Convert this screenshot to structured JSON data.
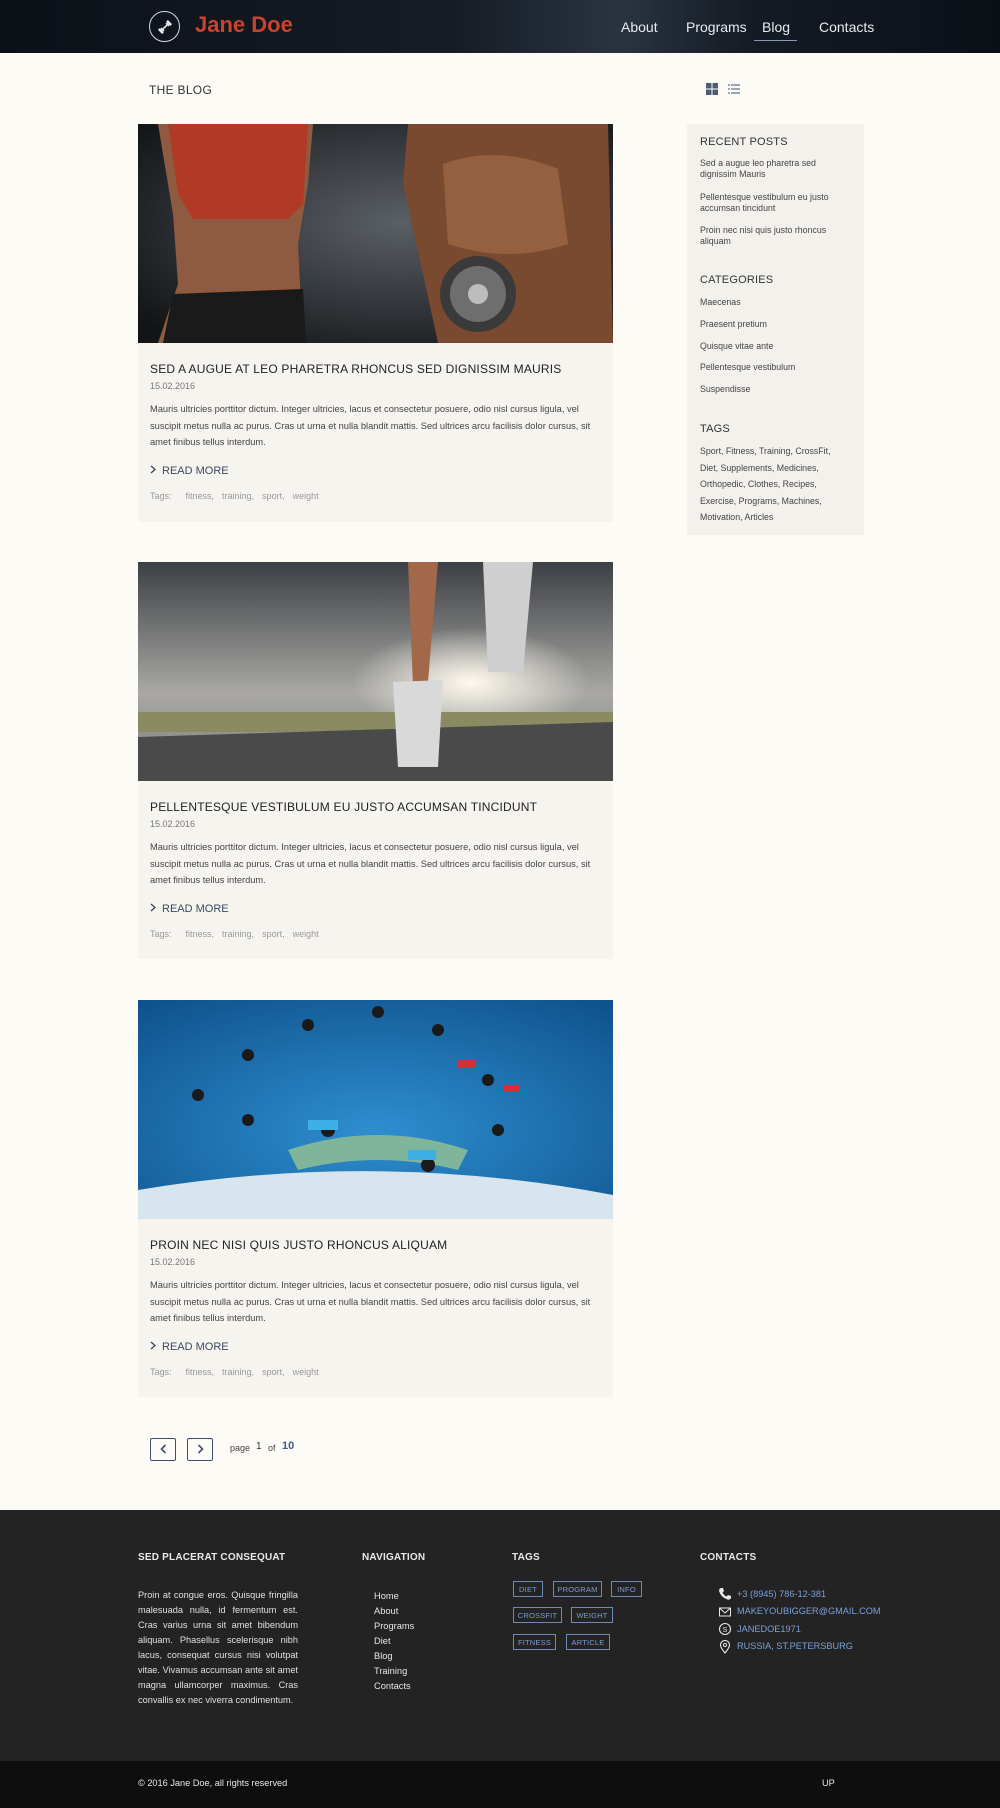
{
  "header": {
    "logo_text": "Jane Doe",
    "nav": [
      {
        "label": "About"
      },
      {
        "label": "Programs"
      },
      {
        "label": "Blog"
      },
      {
        "label": "Contacts"
      }
    ],
    "active_nav": "Blog",
    "logo_icon": "dumbbell-icon"
  },
  "blog": {
    "heading": "THE BLOG",
    "view_icons": [
      "grid-view-icon",
      "list-view-icon"
    ]
  },
  "posts": [
    {
      "title": "SED A AUGUE AT LEO PHARETRA RHONCUS SED DIGNISSIM MAURIS",
      "date": "15.02.2016",
      "text": "Mauris ultricies porttitor dictum. Integer ultricies, lacus et consectetur posuere, odio nisl cursus ligula, vel suscipit metus nulla ac purus. Cras ut urna et nulla blandit mattis. Sed ultrices arcu facilisis dolor cursus, sit amet finibus tellus interdum.",
      "read_more": "READ MORE",
      "tags_label": "Tags:",
      "tags": [
        "fitness,",
        "training,",
        "sport,",
        "weight"
      ]
    },
    {
      "title": "PELLENTESQUE VESTIBULUM EU JUSTO  ACCUMSAN TINCIDUNT",
      "date": "15.02.2016",
      "text": "Mauris ultricies porttitor dictum. Integer ultricies, lacus et consectetur posuere, odio nisl cursus ligula, vel suscipit metus nulla ac purus. Cras ut urna et nulla blandit mattis. Sed ultrices arcu facilisis dolor cursus, sit amet finibus tellus interdum.",
      "read_more": "READ MORE",
      "tags_label": "Tags:",
      "tags": [
        "fitness,",
        "training,",
        "sport,",
        "weight"
      ]
    },
    {
      "title": "PROIN NEC NISI QUIS JUSTO RHONCUS  ALIQUAM",
      "date": "15.02.2016",
      "text": "Mauris ultricies porttitor dictum. Integer ultricies, lacus et consectetur posuere, odio nisl cursus ligula, vel suscipit metus nulla ac purus. Cras ut urna et nulla blandit mattis. Sed ultrices arcu facilisis dolor cursus, sit amet finibus tellus interdum.",
      "read_more": "READ MORE",
      "tags_label": "Tags:",
      "tags": [
        "fitness,",
        "training,",
        "sport,",
        "weight"
      ]
    }
  ],
  "sidebar": {
    "recent_title": "RECENT POSTS",
    "recent_posts": [
      "Sed a augue leo pharetra sed dignissim Mauris",
      "Pellentesque vestibulum eu justo accumsan tincidunt",
      "Proin nec nisi quis justo rhoncus aliquam"
    ],
    "categories_title": "CATEGORIES",
    "categories": [
      "Maecenas",
      "Praesent pretium",
      "Quisque vitae ante",
      "Pellentesque vestibulum",
      "Suspendisse"
    ],
    "tags_title": "TAGS",
    "tags_text": "Sport, Fitness, Training, CrossFit, Diet, Supplements, Medicines, Orthopedic, Clothes, Recipes, Exercise, Programs, Machines, Motivation, Articles"
  },
  "pagination": {
    "page_label": "page",
    "current": "1",
    "of_label": "of",
    "total": "10"
  },
  "footer": {
    "about_title": "SED PLACERAT CONSEQUAT",
    "about_text": "Proin at congue eros. Quisque fringilla malesuada nulla, id fermentum est. Cras varius urna sit amet bibendum aliquam. Phasellus scelerisque nibh lacus, consequat cursus nisi volutpat vitae. Vivamus accumsan ante sit amet magna ullamcorper maximus. Cras convallis ex nec viverra condimentum.",
    "nav_title": "NAVIGATION",
    "nav": [
      "Home",
      "About",
      "Programs",
      "Diet",
      "Blog",
      "Training",
      "Contacts"
    ],
    "tags_title": "TAGS",
    "tags": [
      "DIET",
      "PROGRAM",
      "INFO",
      "CROSSFIT",
      "WEIGHT",
      "FITNESS",
      "ARTICLE"
    ],
    "contacts_title": "CONTACTS",
    "contacts": [
      {
        "icon": "phone-icon",
        "text": "+3 (8945) 786-12-381"
      },
      {
        "icon": "envelope-icon",
        "text": "MAKEYOUBIGGER@GMAIL.COM"
      },
      {
        "icon": "skype-icon",
        "text": "JANEDOE1971"
      },
      {
        "icon": "map-pin-icon",
        "text": "RUSSIA, ST.PETERSBURG"
      }
    ],
    "copyright": "© 2016 Jane Doe, all rights reserved",
    "up": "UP"
  },
  "colors": {
    "accent": "#c9432e",
    "link": "#3e5a8a",
    "footer_bg": "#232323",
    "page_bg": "#fdfbf6"
  }
}
